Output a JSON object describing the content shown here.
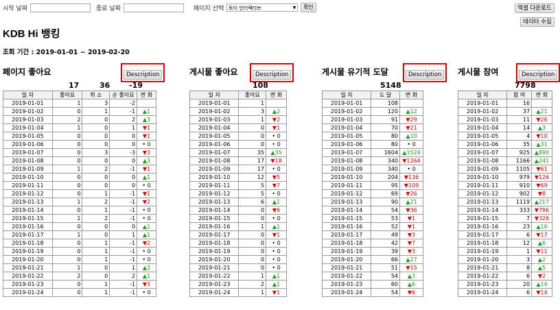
{
  "filters": {
    "start_label": "시작 날짜",
    "end_label": "종료 날짜",
    "page_label": "페이지 선택",
    "page_value": "토이 인터랙티브",
    "confirm_label": "확인"
  },
  "buttons": {
    "excel": "엑셀 다운로드",
    "collect": "데이터 수집"
  },
  "title": "KDB Hi 뱅킹",
  "period": "조회 기간 : 2019-01-01 ~ 2019-02-20",
  "desc_label": "Description",
  "sections": {
    "page_likes": {
      "title": "페이지 좋아요",
      "totals": [
        "17",
        "36",
        "-19"
      ],
      "headers": [
        "일 자",
        "좋아요",
        "취 소",
        "순 좋아요",
        "변 화"
      ],
      "rows": [
        [
          "2019-01-01",
          "1",
          "3",
          "-2",
          ""
        ],
        [
          "2019-01-02",
          "0",
          "1",
          "-1",
          "▲1"
        ],
        [
          "2019-01-03",
          "2",
          "0",
          "2",
          "▲3"
        ],
        [
          "2019-01-04",
          "1",
          "0",
          "1",
          "▼1"
        ],
        [
          "2019-01-05",
          "0",
          "0",
          "0",
          "▼1"
        ],
        [
          "2019-01-06",
          "0",
          "0",
          "0",
          "• 0"
        ],
        [
          "2019-01-07",
          "0",
          "3",
          "-3",
          "▼3"
        ],
        [
          "2019-01-08",
          "0",
          "0",
          "0",
          "▲3"
        ],
        [
          "2019-01-09",
          "1",
          "2",
          "-1",
          "▼1"
        ],
        [
          "2019-01-10",
          "0",
          "0",
          "0",
          "▲1"
        ],
        [
          "2019-01-11",
          "0",
          "0",
          "0",
          "• 0"
        ],
        [
          "2019-01-12",
          "0",
          "1",
          "-1",
          "▼1"
        ],
        [
          "2019-01-13",
          "1",
          "2",
          "-1",
          "▼2"
        ],
        [
          "2019-01-14",
          "0",
          "1",
          "-1",
          "• 0"
        ],
        [
          "2019-01-15",
          "1",
          "2",
          "-1",
          "• 0"
        ],
        [
          "2019-01-16",
          "0",
          "0",
          "0",
          "▲1"
        ],
        [
          "2019-01-17",
          "1",
          "0",
          "1",
          "▲1"
        ],
        [
          "2019-01-18",
          "0",
          "1",
          "-1",
          "▼2"
        ],
        [
          "2019-01-19",
          "0",
          "1",
          "-1",
          "• 0"
        ],
        [
          "2019-01-20",
          "0",
          "1",
          "-1",
          "• 0"
        ],
        [
          "2019-01-21",
          "1",
          "0",
          "1",
          "▲2"
        ],
        [
          "2019-01-22",
          "2",
          "0",
          "2",
          "▲1"
        ],
        [
          "2019-01-23",
          "0",
          "1",
          "-1",
          "▼3"
        ],
        [
          "2019-01-24",
          "0",
          "1",
          "-1",
          "• 0"
        ]
      ]
    },
    "post_likes": {
      "title": "게시물 좋아요",
      "totals": [
        "108"
      ],
      "headers": [
        "일 자",
        "좋아요",
        "변 화"
      ],
      "rows": [
        [
          "2019-01-01",
          "1",
          ""
        ],
        [
          "2019-01-02",
          "3",
          "▲2"
        ],
        [
          "2019-01-03",
          "1",
          "▼2"
        ],
        [
          "2019-01-04",
          "0",
          "▼1"
        ],
        [
          "2019-01-05",
          "0",
          "• 0"
        ],
        [
          "2019-01-06",
          "0",
          "• 0"
        ],
        [
          "2019-01-07",
          "35",
          "▲35"
        ],
        [
          "2019-01-08",
          "17",
          "▼18"
        ],
        [
          "2019-01-09",
          "17",
          "• 0"
        ],
        [
          "2019-01-10",
          "12",
          "▼5"
        ],
        [
          "2019-01-11",
          "5",
          "▼7"
        ],
        [
          "2019-01-12",
          "5",
          "• 0"
        ],
        [
          "2019-01-13",
          "6",
          "▲1"
        ],
        [
          "2019-01-14",
          "0",
          "▼6"
        ],
        [
          "2019-01-15",
          "0",
          "• 0"
        ],
        [
          "2019-01-16",
          "1",
          "▲1"
        ],
        [
          "2019-01-17",
          "0",
          "▼1"
        ],
        [
          "2019-01-18",
          "0",
          "• 0"
        ],
        [
          "2019-01-19",
          "0",
          "• 0"
        ],
        [
          "2019-01-20",
          "0",
          "• 0"
        ],
        [
          "2019-01-21",
          "0",
          "• 0"
        ],
        [
          "2019-01-22",
          "1",
          "▲1"
        ],
        [
          "2019-01-23",
          "2",
          "▲1"
        ],
        [
          "2019-01-24",
          "1",
          "▼1"
        ]
      ]
    },
    "organic_reach": {
      "title": "게시물 유기적 도달",
      "totals": [
        "5148"
      ],
      "headers": [
        "일 자",
        "도 달",
        "변 화"
      ],
      "rows": [
        [
          "2019-01-01",
          "108",
          ""
        ],
        [
          "2019-01-02",
          "120",
          "▲12"
        ],
        [
          "2019-01-03",
          "91",
          "▼29"
        ],
        [
          "2019-01-04",
          "70",
          "▼21"
        ],
        [
          "2019-01-05",
          "80",
          "▲10"
        ],
        [
          "2019-01-06",
          "80",
          "• 0"
        ],
        [
          "2019-01-07",
          "1604",
          "▲1524"
        ],
        [
          "2019-01-08",
          "340",
          "▼1264"
        ],
        [
          "2019-01-09",
          "340",
          "• 0"
        ],
        [
          "2019-01-10",
          "204",
          "▼136"
        ],
        [
          "2019-01-11",
          "95",
          "▼109"
        ],
        [
          "2019-01-12",
          "69",
          "▼26"
        ],
        [
          "2019-01-13",
          "90",
          "▲21"
        ],
        [
          "2019-01-14",
          "54",
          "▼36"
        ],
        [
          "2019-01-15",
          "53",
          "▼1"
        ],
        [
          "2019-01-16",
          "52",
          "▼1"
        ],
        [
          "2019-01-17",
          "49",
          "▼3"
        ],
        [
          "2019-01-18",
          "42",
          "▼7"
        ],
        [
          "2019-01-19",
          "39",
          "▼3"
        ],
        [
          "2019-01-20",
          "66",
          "▲27"
        ],
        [
          "2019-01-21",
          "51",
          "▼15"
        ],
        [
          "2019-01-22",
          "54",
          "▲3"
        ],
        [
          "2019-01-23",
          "60",
          "▲6"
        ],
        [
          "2019-01-24",
          "54",
          "▼6"
        ]
      ]
    },
    "engagement": {
      "title": "게시물 참여",
      "totals": [
        "7798"
      ],
      "headers": [
        "일 자",
        "참 여",
        "변 화"
      ],
      "rows": [
        [
          "2019-01-01",
          "16",
          ""
        ],
        [
          "2019-01-02",
          "37",
          "▲21"
        ],
        [
          "2019-01-03",
          "11",
          "▼26"
        ],
        [
          "2019-01-04",
          "14",
          "▲3"
        ],
        [
          "2019-01-05",
          "4",
          "▼10"
        ],
        [
          "2019-01-06",
          "35",
          "▲31"
        ],
        [
          "2019-01-07",
          "925",
          "▲890"
        ],
        [
          "2019-01-08",
          "1166",
          "▲241"
        ],
        [
          "2019-01-09",
          "1105",
          "▼61"
        ],
        [
          "2019-01-10",
          "979",
          "▼126"
        ],
        [
          "2019-01-11",
          "910",
          "▼69"
        ],
        [
          "2019-01-12",
          "902",
          "▼8"
        ],
        [
          "2019-01-13",
          "1119",
          "▲217"
        ],
        [
          "2019-01-14",
          "333",
          "▼786"
        ],
        [
          "2019-01-15",
          "7",
          "▼326"
        ],
        [
          "2019-01-16",
          "23",
          "▲16"
        ],
        [
          "2019-01-17",
          "6",
          "▼17"
        ],
        [
          "2019-01-18",
          "12",
          "▲6"
        ],
        [
          "2019-01-19",
          "1",
          "▼11"
        ],
        [
          "2019-01-20",
          "3",
          "▲2"
        ],
        [
          "2019-01-21",
          "8",
          "▲5"
        ],
        [
          "2019-01-22",
          "6",
          "▼2"
        ],
        [
          "2019-01-23",
          "20",
          "▲14"
        ],
        [
          "2019-01-24",
          "6",
          "▼14"
        ]
      ]
    }
  }
}
